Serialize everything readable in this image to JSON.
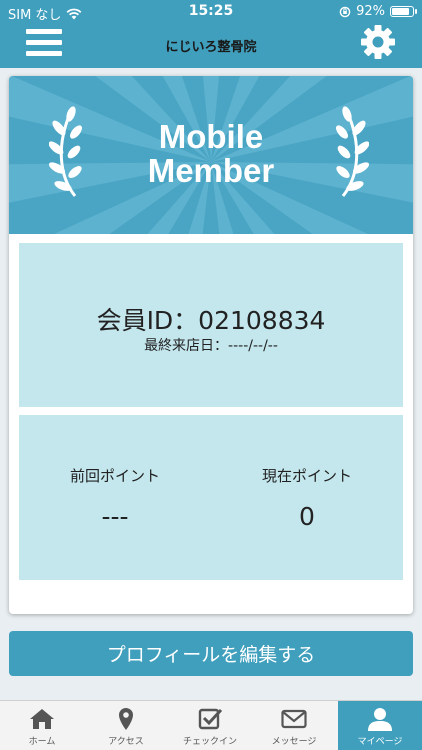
{
  "status_bar": {
    "carrier": "SIM なし",
    "time": "15:25",
    "battery": "92%",
    "battery_level": 0.92
  },
  "header": {
    "logo": "にじいろ整骨院"
  },
  "card": {
    "banner_title_line1": "Mobile",
    "banner_title_line2": "Member",
    "member_id": "会員ID：02108834",
    "last_visit": "最終来店日：----/--/--",
    "points": {
      "previous_label": "前回ポイント",
      "previous_value": "---",
      "current_label": "現在ポイント",
      "current_value": "0"
    }
  },
  "profile_button": "プロフィールを編集する",
  "tabs": [
    {
      "label": "ホーム",
      "icon": "home-icon"
    },
    {
      "label": "アクセス",
      "icon": "map-pin-icon"
    },
    {
      "label": "チェックイン",
      "icon": "checkin-icon"
    },
    {
      "label": "メッセージ",
      "icon": "envelope-icon"
    },
    {
      "label": "マイページ",
      "icon": "user-icon",
      "active": true
    }
  ],
  "colors": {
    "accent": "#3f9fbd",
    "panel": "#c4e7ee",
    "banner": "#4aa5c4"
  }
}
